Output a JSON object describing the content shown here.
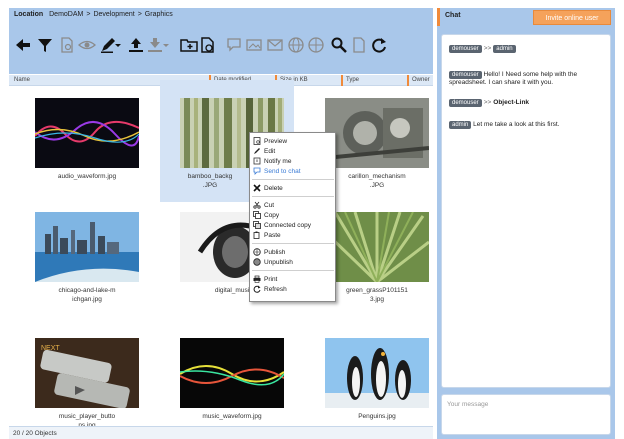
{
  "location": {
    "label": "Location",
    "path": [
      "DemoDAM",
      "Development",
      "Graphics"
    ],
    "separator": ">"
  },
  "toolbar": {
    "icons": [
      "back-arrow-icon",
      "filter-icon",
      "document-preview-icon",
      "eye-icon",
      "pen-icon",
      "upload-icon",
      "download-icon",
      "new-folder-icon",
      "new-file-icon",
      "comment-icon",
      "image-edit-icon",
      "email-icon",
      "globe-icon",
      "network-icon",
      "search-icon",
      "blank-page-icon",
      "refresh-icon"
    ]
  },
  "columns": [
    "Name",
    "Date modified",
    "Size in KB",
    "Type",
    "Owner"
  ],
  "files": [
    {
      "name": "audio_waveform.jpg"
    },
    {
      "name": "bamboo_backg...JPG",
      "selected": true
    },
    {
      "name": "carillon_mechanism.JPG"
    },
    {
      "name": "chicago-and-lake-michgan.jpg"
    },
    {
      "name": "digital_music..."
    },
    {
      "name": "green_grassP101151 3.jpg"
    },
    {
      "name": "music_player_button.jpg"
    },
    {
      "name": "music_waveform.jpg"
    },
    {
      "name": "Penguins.jpg"
    }
  ],
  "captions": {
    "f0": "audio_waveform.jpg",
    "f1a": "bamboo_backg",
    "f1b": ".JPG",
    "f2a": "carillon_mechanism",
    "f2b": ".JPG",
    "f3a": "chicago-and-lake-m",
    "f3b": "ichgan.jpg",
    "f4": "digital_musi",
    "f5a": "green_grassP101151",
    "f5b": "3.jpg",
    "f6a": "music_player_butto",
    "f6b": "ns.jpg",
    "f7": "music_waveform.jpg",
    "f8": "Penguins.jpg"
  },
  "status": "20 / 20 Objects",
  "context_menu": {
    "items": [
      "Preview",
      "Edit",
      "Notify me",
      "Send to chat",
      "Delete",
      "Cut",
      "Copy",
      "Connected copy",
      "Paste",
      "Publish",
      "Unpublish",
      "Print",
      "Refresh"
    ]
  },
  "chat": {
    "title": "Chat",
    "invite_label": "Invite online user",
    "messages": [
      {
        "from": "demouser",
        "to": "admin",
        "text": ""
      },
      {
        "from": "demouser",
        "text": "Hello! I Need some help with the spreadsheet. I can share it with you."
      },
      {
        "from": "demouser",
        "arrow": ">>",
        "link": "Object-Link"
      },
      {
        "from": "admin",
        "text": "Let me take a look at this first."
      }
    ],
    "arrow": ">>",
    "input_placeholder": "Your message"
  }
}
